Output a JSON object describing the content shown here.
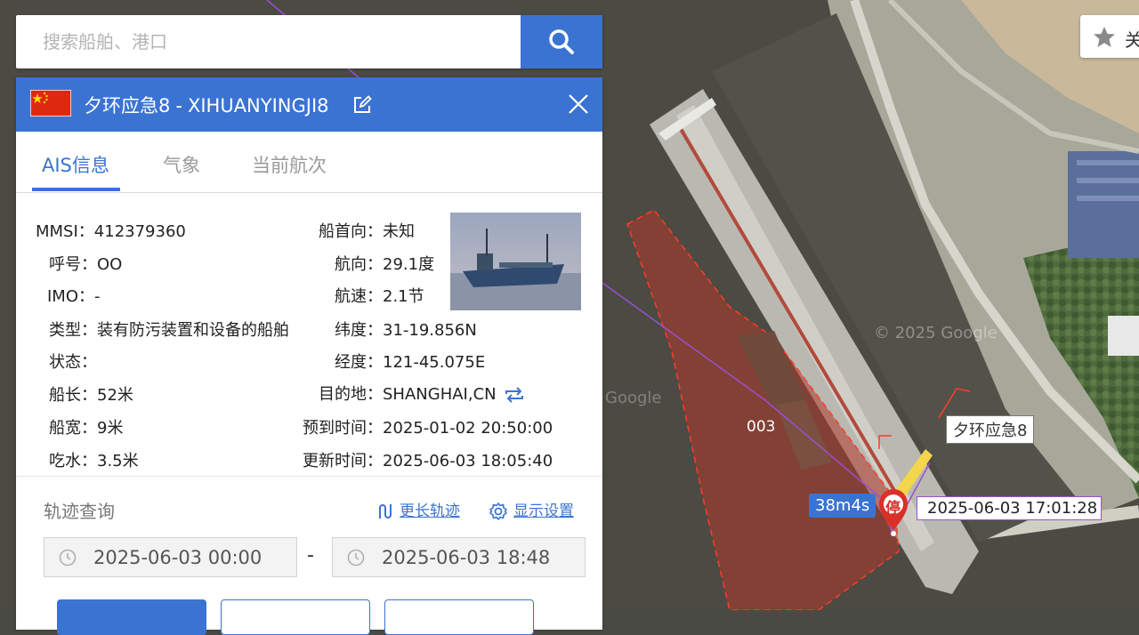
{
  "search": {
    "placeholder": "搜索船舶、港口"
  },
  "ship": {
    "name_cn": "夕环应急8",
    "separator": "-",
    "name_en": "XIHUANYINGJI8"
  },
  "tabs": [
    {
      "label": "AIS信息"
    },
    {
      "label": "气象"
    },
    {
      "label": "当前航次"
    }
  ],
  "info_left": [
    {
      "label": "MMSI：",
      "value": "412379360"
    },
    {
      "label": "呼号：",
      "value": "OO"
    },
    {
      "label": "IMO：",
      "value": "-"
    },
    {
      "label": "类型：",
      "value": "装有防污装置和设备的船舶"
    },
    {
      "label": "状态：",
      "value": ""
    },
    {
      "label": "船长：",
      "value": "52米"
    },
    {
      "label": "船宽：",
      "value": "9米"
    },
    {
      "label": "吃水：",
      "value": "3.5米"
    }
  ],
  "info_right": [
    {
      "label": "船首向：",
      "value": "未知"
    },
    {
      "label": "航向：",
      "value": "29.1度"
    },
    {
      "label": "航速：",
      "value": "2.1节"
    },
    {
      "label": "纬度：",
      "value": "31-19.856N"
    },
    {
      "label": "经度：",
      "value": "121-45.075E"
    },
    {
      "label": "目的地：",
      "value": "SHANGHAI,CN"
    },
    {
      "label": "预到时间：",
      "value": "2025-01-02 20:50:00"
    },
    {
      "label": "更新时间：",
      "value": "2025-06-03 18:05:40"
    }
  ],
  "track": {
    "title": "轨迹查询",
    "longer_link": "更长轨迹",
    "settings_link": "显示设置",
    "start": "2025-06-03 00:00",
    "dash": "-",
    "end": "2025-06-03 18:48"
  },
  "follow_button": {
    "label": "关"
  },
  "map": {
    "berth_label": "003",
    "ship_label": "夕环应急8",
    "duration_badge": "38m4s",
    "stop_marker": "停",
    "time_label": "2025-06-03 17:01:28",
    "watermark": "© 2025 Google",
    "watermark2": "Google"
  },
  "colors": {
    "accent": "#3b73d3",
    "zone_fill": "#b23a2c",
    "stop_marker": "#d9302a"
  }
}
